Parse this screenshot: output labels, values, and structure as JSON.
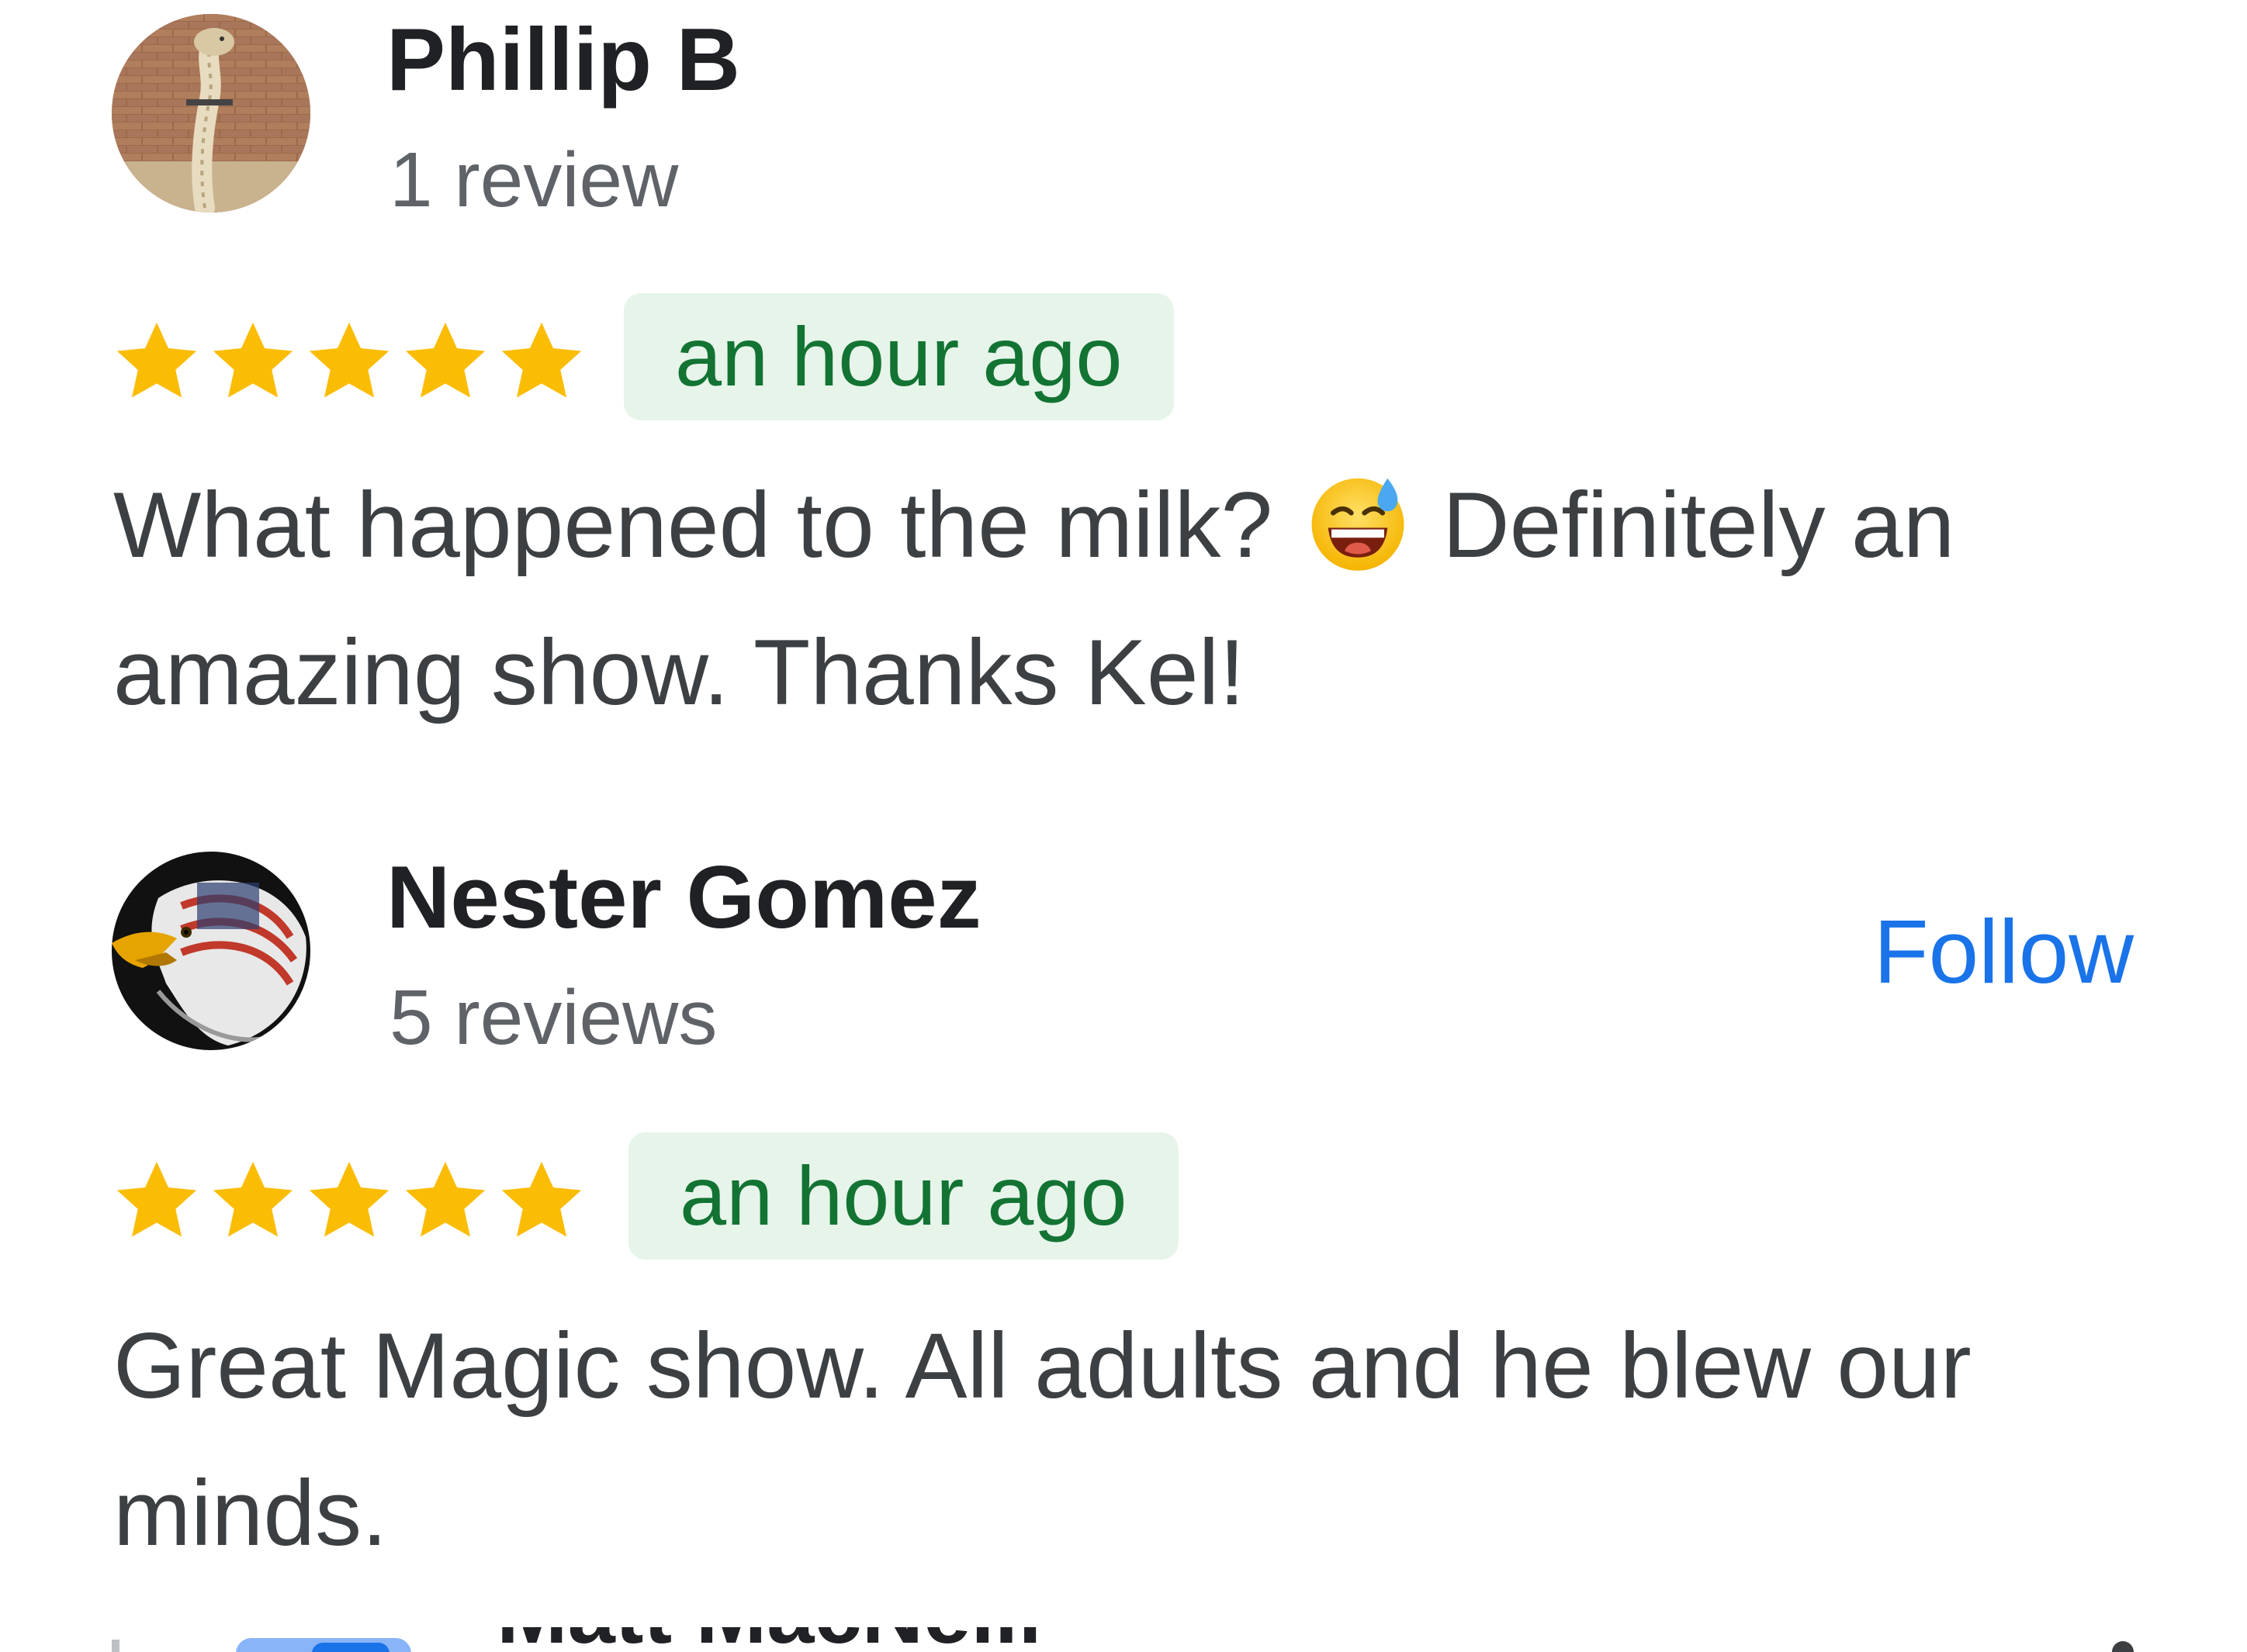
{
  "reviews": [
    {
      "name": "Phillip B",
      "review_count": "1 review",
      "rating": 5,
      "time": "an hour ago",
      "text_before_emoji": "What happened to the milk?",
      "emoji": "grinning-face-with-sweat",
      "text_after_emoji": "Definitely an amazing show. Thanks Kel!",
      "avatar": "snake-photo-avatar"
    },
    {
      "name": "Nester Gomez",
      "review_count": "5 reviews",
      "rating": 5,
      "time": "an hour ago",
      "text": "Great Magic show. All adults and he blew our minds.",
      "follow_label": "Follow",
      "avatar": "eagle-flag-avatar"
    }
  ],
  "next_review_partial_name": "Matt MacNeill",
  "colors": {
    "star": "#fbbc04",
    "badge_bg": "#e6f4ea",
    "badge_text": "#137333",
    "follow": "#1a73e8",
    "name": "#202124",
    "body_text": "#3c4043",
    "meta": "#5f6368"
  }
}
